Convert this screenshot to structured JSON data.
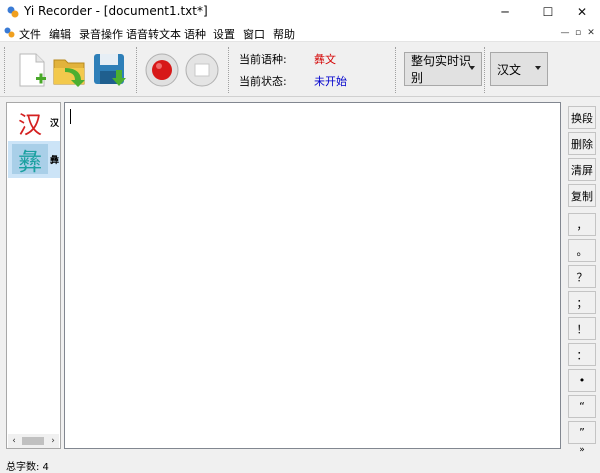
{
  "window": {
    "title": "Yi Recorder - [document1.txt*]",
    "controls": {
      "minimize": "─",
      "maximize": "☐",
      "close": "✕"
    }
  },
  "menu": {
    "items": [
      "文件",
      "编辑",
      "录音操作",
      "语音转文本",
      "语种",
      "设置",
      "窗口",
      "帮助"
    ],
    "mdi": {
      "minimize": "—",
      "restore": "▫",
      "close": "✕"
    }
  },
  "toolbar": {
    "icons": [
      "new-document-icon",
      "open-folder-icon",
      "save-icon",
      "record-icon",
      "stop-icon"
    ],
    "current_language_label": "当前语种:",
    "current_language_value": "彝文",
    "current_state_label": "当前状态:",
    "current_state_value": "未开始",
    "recognition_mode": "整句实时识别",
    "output_language": "汉文",
    "colors": {
      "language_value": "#d40000",
      "state_value": "#0000cc"
    }
  },
  "languages": [
    {
      "glyph": "汉",
      "name": "汉",
      "color": "#d42020",
      "selected": false
    },
    {
      "glyph": "彝",
      "name": "彝",
      "color": "#1ba0a0",
      "selected": true
    }
  ],
  "editor": {
    "text": ""
  },
  "side_buttons": [
    "换段",
    "删除",
    "清屏",
    "复制",
    "，",
    "。",
    "？",
    "；",
    "！",
    "：",
    "•",
    "“",
    "”",
    "»"
  ],
  "status": {
    "char_count": "总字数:  4"
  }
}
